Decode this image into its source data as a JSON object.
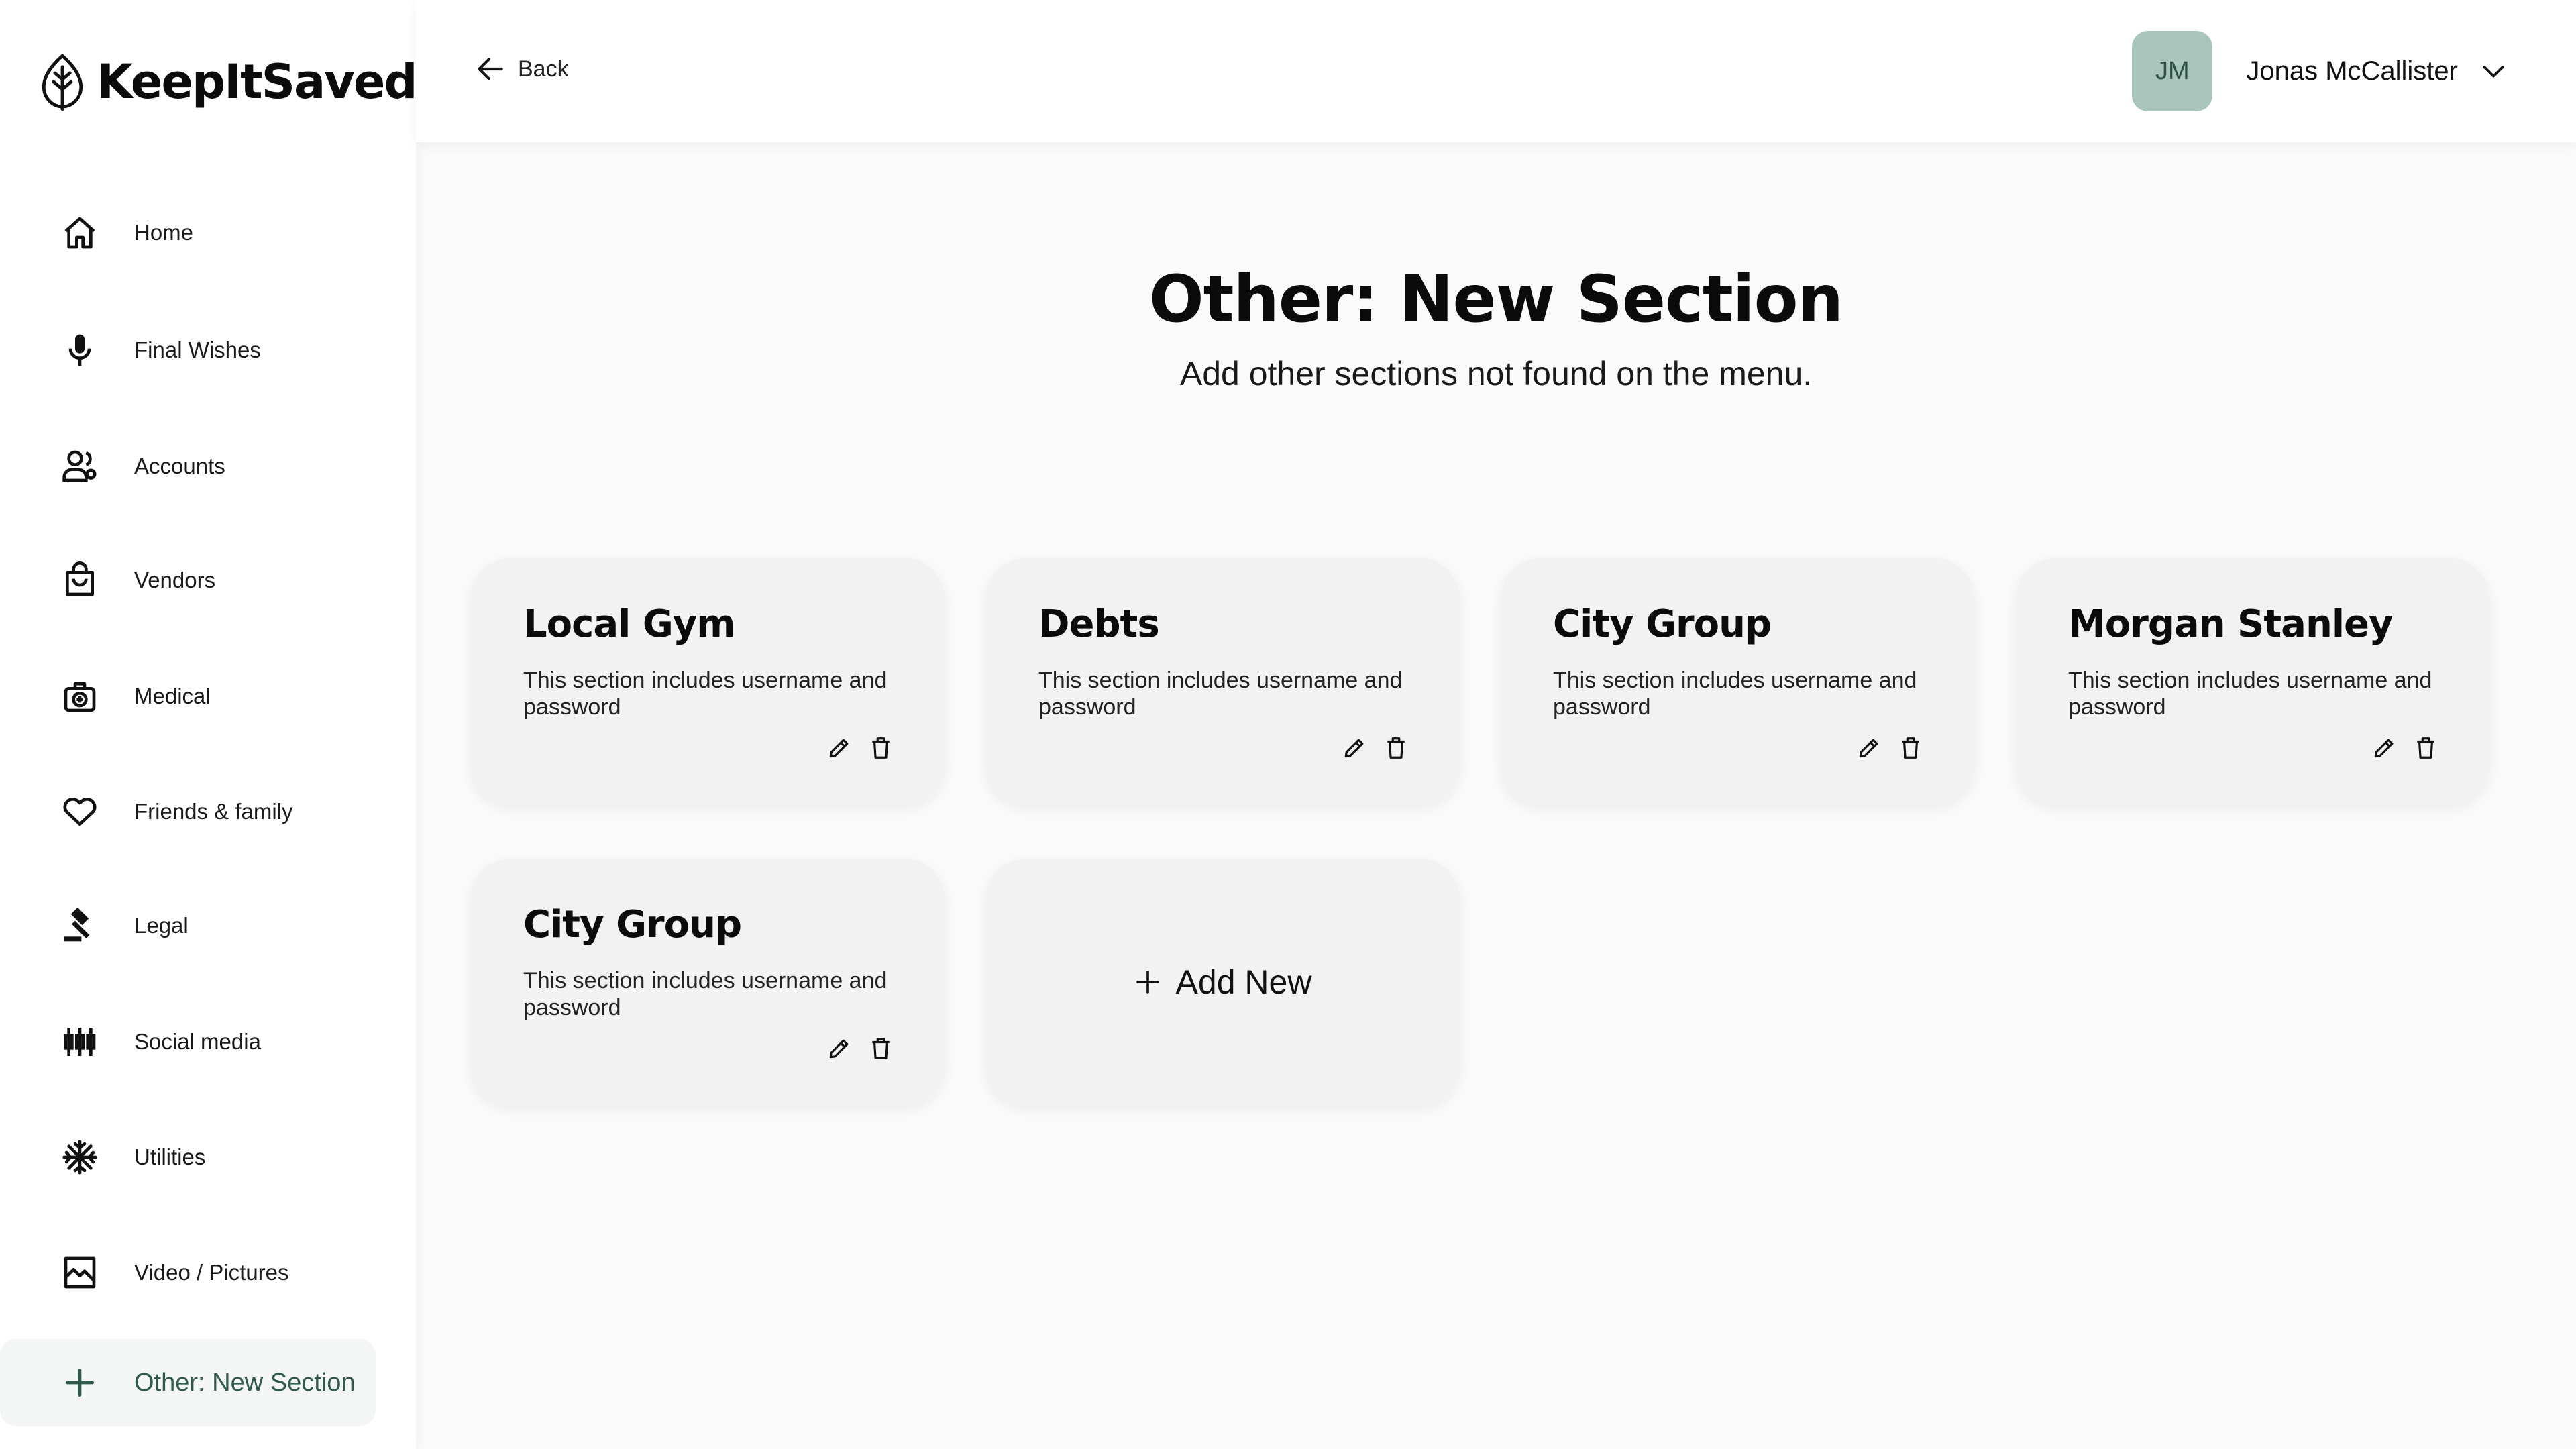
{
  "app": {
    "logo_text": "KeepItSaved"
  },
  "sidebar": {
    "items": [
      {
        "label": "Home",
        "icon": "home-icon"
      },
      {
        "label": "Final Wishes",
        "icon": "microphone-icon"
      },
      {
        "label": "Accounts",
        "icon": "users-icon"
      },
      {
        "label": "Vendors",
        "icon": "shopping-bag-icon"
      },
      {
        "label": "Medical",
        "icon": "medical-bag-icon"
      },
      {
        "label": "Friends & family",
        "icon": "heart-icon"
      },
      {
        "label": "Legal",
        "icon": "gavel-icon"
      },
      {
        "label": "Social media",
        "icon": "social-icon"
      },
      {
        "label": "Utilities",
        "icon": "snowflake-icon"
      },
      {
        "label": "Video / Pictures",
        "icon": "image-icon"
      },
      {
        "label": "Other: New Section",
        "icon": "plus-icon",
        "active": true
      }
    ]
  },
  "topbar": {
    "back_label": "Back",
    "user": {
      "initials": "JM",
      "name": "Jonas McCallister"
    }
  },
  "main": {
    "title": "Other: New Section",
    "subtitle": "Add other sections not found on the menu.",
    "cards": [
      {
        "title": "Local Gym",
        "description": "This section includes username and password"
      },
      {
        "title": "Debts",
        "description": "This section includes username and password"
      },
      {
        "title": "City Group",
        "description": "This section includes username and password"
      },
      {
        "title": "Morgan Stanley",
        "description": "This section includes username and password"
      },
      {
        "title": "City Group",
        "description": "This section includes username and password"
      }
    ],
    "add_new_label": "Add New"
  },
  "colors": {
    "accent": "#2f5a4d",
    "avatar_bg": "#a9c5bc",
    "card_bg": "#f2f2f2",
    "page_bg": "#fafafa"
  }
}
